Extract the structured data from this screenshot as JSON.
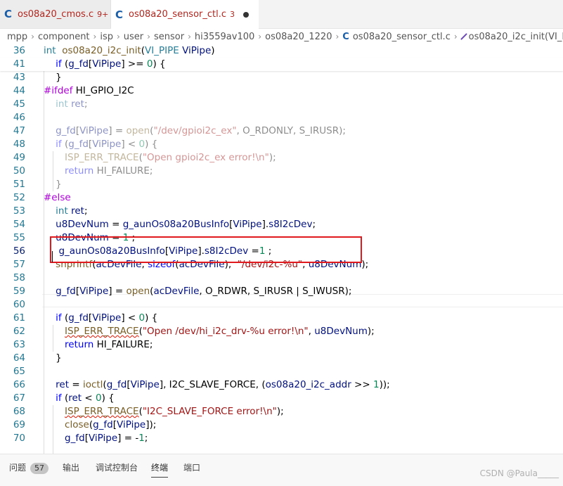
{
  "tabs": [
    {
      "name": "os08a20_cmos.c",
      "badge": "9+",
      "active": false
    },
    {
      "name": "os08a20_sensor_ctl.c",
      "badge": "3",
      "active": true
    }
  ],
  "breadcrumb": [
    "mpp",
    "component",
    "isp",
    "user",
    "sensor",
    "hi3559av100",
    "os08a20_1220",
    "os08a20_sensor_ctl.c",
    "os08a20_i2c_init(VI_PIPE ViPipe)"
  ],
  "code": {
    "sticky": [
      {
        "ln": "36",
        "tokens": [
          [
            "ty",
            "int"
          ],
          [
            "",
            "  "
          ],
          [
            "fn",
            "os08a20_i2c_init"
          ],
          [
            "",
            "("
          ],
          [
            "ty",
            "VI_PIPE"
          ],
          [
            "",
            " "
          ],
          [
            "vr",
            "ViPipe"
          ],
          [
            "",
            ")"
          ]
        ]
      },
      {
        "ln": "41",
        "tokens": [
          [
            "",
            "    "
          ],
          [
            "kw",
            "if"
          ],
          [
            "",
            " ("
          ],
          [
            "vr",
            "g_fd"
          ],
          [
            "",
            "["
          ],
          [
            "vr",
            "ViPipe"
          ],
          [
            "",
            "] >= "
          ],
          [
            "nm",
            "0"
          ],
          [
            "",
            ") {"
          ]
        ]
      }
    ],
    "lines": [
      {
        "ln": "43",
        "tokens": [
          [
            "",
            "    }"
          ]
        ]
      },
      {
        "ln": "44",
        "tokens": [
          [
            "pp",
            "#ifdef"
          ],
          [
            "",
            " HI_GPIO_I2C"
          ]
        ],
        "dim": false
      },
      {
        "ln": "45",
        "tokens": [
          [
            "",
            "    "
          ],
          [
            "ty",
            "int"
          ],
          [
            "",
            " "
          ],
          [
            "vr",
            "ret"
          ],
          [
            "",
            ";"
          ]
        ],
        "dim": true
      },
      {
        "ln": "46",
        "tokens": []
      },
      {
        "ln": "47",
        "tokens": [
          [
            "",
            "    "
          ],
          [
            "vr",
            "g_fd"
          ],
          [
            "",
            "["
          ],
          [
            "vr",
            "ViPipe"
          ],
          [
            "",
            "] = "
          ],
          [
            "fn",
            "open"
          ],
          [
            "",
            "("
          ],
          [
            "st",
            "\"/dev/gpioi2c_ex\""
          ],
          [
            "",
            ", O_RDONLY, S_IRUSR);"
          ]
        ],
        "dim": true
      },
      {
        "ln": "48",
        "tokens": [
          [
            "",
            "    "
          ],
          [
            "kw",
            "if"
          ],
          [
            "",
            " ("
          ],
          [
            "vr",
            "g_fd"
          ],
          [
            "",
            "["
          ],
          [
            "vr",
            "ViPipe"
          ],
          [
            "",
            "] < "
          ],
          [
            "nm",
            "0"
          ],
          [
            "",
            ") {"
          ]
        ],
        "dim": true
      },
      {
        "ln": "49",
        "tokens": [
          [
            "",
            "       "
          ],
          [
            "fn",
            "ISP_ERR_TRACE"
          ],
          [
            "",
            "("
          ],
          [
            "st",
            "\"Open gpioi2c_ex error!\\n\""
          ],
          [
            "",
            ");"
          ]
        ],
        "dim": true
      },
      {
        "ln": "50",
        "tokens": [
          [
            "",
            "       "
          ],
          [
            "kw",
            "return"
          ],
          [
            "",
            " HI_FAILURE;"
          ]
        ],
        "dim": true
      },
      {
        "ln": "51",
        "tokens": [
          [
            "",
            "    }"
          ]
        ],
        "dim": true
      },
      {
        "ln": "52",
        "tokens": [
          [
            "pp",
            "#else"
          ]
        ]
      },
      {
        "ln": "53",
        "tokens": [
          [
            "",
            "    "
          ],
          [
            "ty",
            "int"
          ],
          [
            "",
            " "
          ],
          [
            "vr",
            "ret"
          ],
          [
            "",
            ";"
          ]
        ]
      },
      {
        "ln": "54",
        "tokens": [
          [
            "",
            "    "
          ],
          [
            "vr",
            "u8DevNum"
          ],
          [
            "",
            " = "
          ],
          [
            "vr",
            "g_aunOs08a20BusInfo"
          ],
          [
            "",
            "["
          ],
          [
            "vr",
            "ViPipe"
          ],
          [
            "",
            "]."
          ],
          [
            "vr",
            "s8I2cDev"
          ],
          [
            "",
            ";"
          ]
        ]
      },
      {
        "ln": "55",
        "tokens": [
          [
            "",
            "    "
          ],
          [
            "vr",
            "u8DevNum"
          ],
          [
            "",
            " = "
          ],
          [
            "nm",
            "1"
          ],
          [
            "",
            " ;"
          ]
        ]
      },
      {
        "ln": "56",
        "tokens": [
          [
            "",
            "     "
          ],
          [
            "vr",
            "g_aunOs08a20BusInfo"
          ],
          [
            "",
            "["
          ],
          [
            "vr",
            "ViPipe"
          ],
          [
            "",
            "]."
          ],
          [
            "vr",
            "s8I2cDev"
          ],
          [
            "",
            " ="
          ],
          [
            "nm",
            "1"
          ],
          [
            "",
            " ;"
          ]
        ],
        "current": true
      },
      {
        "ln": "57",
        "tokens": [
          [
            "",
            "    "
          ],
          [
            "fn",
            "snprintf"
          ],
          [
            "",
            "("
          ],
          [
            "vr",
            "acDevFile"
          ],
          [
            "",
            ", "
          ],
          [
            "kw",
            "sizeof"
          ],
          [
            "",
            "("
          ],
          [
            "vr",
            "acDevFile"
          ],
          [
            "",
            "),  "
          ],
          [
            "st",
            "\"/dev/i2c-%u\""
          ],
          [
            "",
            ", "
          ],
          [
            "vr",
            "u8DevNum"
          ],
          [
            "",
            ");"
          ]
        ]
      },
      {
        "ln": "58",
        "tokens": []
      },
      {
        "ln": "59",
        "tokens": [
          [
            "",
            "    "
          ],
          [
            "vr",
            "g_fd"
          ],
          [
            "",
            "["
          ],
          [
            "vr",
            "ViPipe"
          ],
          [
            "",
            "] = "
          ],
          [
            "fn",
            "open"
          ],
          [
            "",
            "("
          ],
          [
            "vr",
            "acDevFile"
          ],
          [
            "",
            ", O_RDWR, S_IRUSR | S_IWUSR);"
          ]
        ]
      },
      {
        "ln": "60",
        "tokens": []
      },
      {
        "ln": "61",
        "tokens": [
          [
            "",
            "    "
          ],
          [
            "kw",
            "if"
          ],
          [
            "",
            " ("
          ],
          [
            "vr",
            "g_fd"
          ],
          [
            "",
            "["
          ],
          [
            "vr",
            "ViPipe"
          ],
          [
            "",
            "] < "
          ],
          [
            "nm",
            "0"
          ],
          [
            "",
            ") {"
          ]
        ]
      },
      {
        "ln": "62",
        "tokens": [
          [
            "",
            "       "
          ],
          [
            "fn",
            "ISP_ERR_TRACE",
            "squig"
          ],
          [
            "",
            "("
          ],
          [
            "st",
            "\"Open /dev/hi_i2c_drv-%u error!\\n\""
          ],
          [
            "",
            ", "
          ],
          [
            "vr",
            "u8DevNum"
          ],
          [
            "",
            ");"
          ]
        ]
      },
      {
        "ln": "63",
        "tokens": [
          [
            "",
            "       "
          ],
          [
            "kw",
            "return"
          ],
          [
            "",
            " HI_FAILURE;"
          ]
        ]
      },
      {
        "ln": "64",
        "tokens": [
          [
            "",
            "    }"
          ]
        ]
      },
      {
        "ln": "65",
        "tokens": []
      },
      {
        "ln": "66",
        "tokens": [
          [
            "",
            "    "
          ],
          [
            "vr",
            "ret"
          ],
          [
            "",
            " = "
          ],
          [
            "fn",
            "ioctl"
          ],
          [
            "",
            "("
          ],
          [
            "vr",
            "g_fd"
          ],
          [
            "",
            "["
          ],
          [
            "vr",
            "ViPipe"
          ],
          [
            "",
            "], I2C_SLAVE_FORCE, ("
          ],
          [
            "vr",
            "os08a20_i2c_addr"
          ],
          [
            "",
            " >> "
          ],
          [
            "nm",
            "1"
          ],
          [
            "",
            "));"
          ]
        ]
      },
      {
        "ln": "67",
        "tokens": [
          [
            "",
            "    "
          ],
          [
            "kw",
            "if"
          ],
          [
            "",
            " ("
          ],
          [
            "vr",
            "ret"
          ],
          [
            "",
            " < "
          ],
          [
            "nm",
            "0"
          ],
          [
            "",
            ") {"
          ]
        ]
      },
      {
        "ln": "68",
        "tokens": [
          [
            "",
            "       "
          ],
          [
            "fn",
            "ISP_ERR_TRACE",
            "squig"
          ],
          [
            "",
            "("
          ],
          [
            "st",
            "\"I2C_SLAVE_FORCE error!\\n\""
          ],
          [
            "",
            ");"
          ]
        ]
      },
      {
        "ln": "69",
        "tokens": [
          [
            "",
            "       "
          ],
          [
            "fn",
            "close"
          ],
          [
            "",
            "("
          ],
          [
            "vr",
            "g_fd"
          ],
          [
            "",
            "["
          ],
          [
            "vr",
            "ViPipe"
          ],
          [
            "",
            "]);"
          ]
        ]
      },
      {
        "ln": "70",
        "tokens": [
          [
            "",
            "       "
          ],
          [
            "vr",
            "g_fd"
          ],
          [
            "",
            "["
          ],
          [
            "vr",
            "ViPipe"
          ],
          [
            "",
            "] = -"
          ],
          [
            "nm",
            "1"
          ],
          [
            "",
            ";"
          ]
        ]
      }
    ]
  },
  "panel": {
    "tabs": [
      {
        "label": "问题",
        "badge": "57"
      },
      {
        "label": "输出"
      },
      {
        "label": "调试控制台"
      },
      {
        "label": "终端",
        "active": true
      },
      {
        "label": "端口"
      }
    ]
  },
  "watermark": "CSDN @Paula_____"
}
